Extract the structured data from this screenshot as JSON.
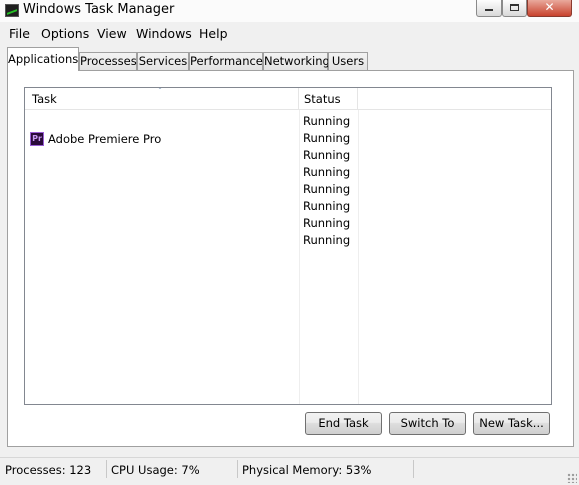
{
  "window": {
    "title": "Windows Task Manager",
    "close_glyph": "✕"
  },
  "menu": [
    "File",
    "Options",
    "View",
    "Windows",
    "Help"
  ],
  "tabs": [
    "Applications",
    "Processes",
    "Services",
    "Performance",
    "Networking",
    "Users"
  ],
  "active_tab": "Applications",
  "list": {
    "columns": [
      "Task",
      "Status"
    ],
    "sort_indicator": "ˆ",
    "tasks": [
      {
        "name": "Adobe Premiere Pro",
        "icon": "premiere-pro-icon",
        "icon_text": "Pr"
      }
    ],
    "statuses": [
      "Running",
      "Running",
      "Running",
      "Running",
      "Running",
      "Running",
      "Running",
      "Running"
    ]
  },
  "buttons": {
    "end_task": "End Task",
    "switch_to": "Switch To",
    "new_task": "New Task..."
  },
  "statusbar": {
    "processes": "Processes: 123",
    "cpu": "CPU Usage: 7%",
    "memory": "Physical Memory: 53%"
  },
  "colors": {
    "premiere_icon_bg": "#2a0a3a",
    "premiere_icon_fg": "#c89af2",
    "close_button": "#c8422d"
  }
}
